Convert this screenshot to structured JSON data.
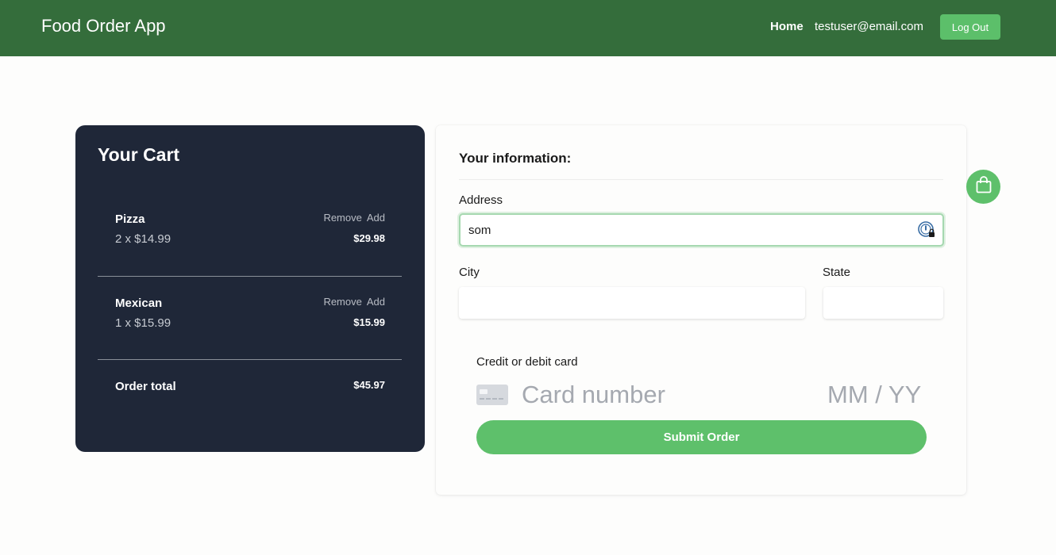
{
  "header": {
    "brand": "Food Order App",
    "nav_home": "Home",
    "user_email": "testuser@email.com",
    "logout_label": "Log Out"
  },
  "cart": {
    "title": "Your Cart",
    "items": [
      {
        "name": "Pizza",
        "qty_text": "2 x $14.99",
        "remove_label": "Remove",
        "add_label": "Add",
        "price": "$29.98"
      },
      {
        "name": "Mexican",
        "qty_text": "1 x $15.99",
        "remove_label": "Remove",
        "add_label": "Add",
        "price": "$15.99"
      }
    ],
    "total_label": "Order total",
    "total_value": "$45.97"
  },
  "form": {
    "heading": "Your information:",
    "address_label": "Address",
    "address_value": "som",
    "city_label": "City",
    "city_value": "",
    "state_label": "State",
    "state_value": "",
    "card_label": "Credit or debit card",
    "card_number_placeholder": "Card number",
    "card_exp_placeholder": "MM / YY",
    "submit_label": "Submit Order"
  },
  "icons": {
    "bag": "shopping-bag-icon",
    "card": "credit-card-icon",
    "password_manager": "password-manager-icon"
  },
  "colors": {
    "header_bg": "#346d3b",
    "accent_green": "#5ec06b",
    "cart_bg": "#1f2738"
  }
}
